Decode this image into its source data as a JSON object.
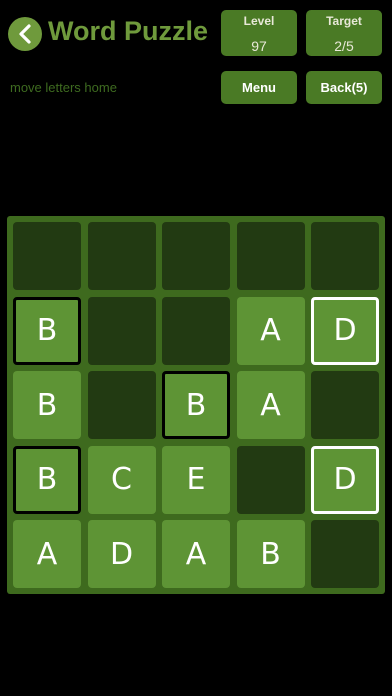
{
  "header": {
    "title": "Word Puzzle",
    "subtitle": "move letters home"
  },
  "level": {
    "label": "Level",
    "value": "97"
  },
  "target": {
    "label": "Target",
    "value": "2/5"
  },
  "buttons": {
    "menu": "Menu",
    "back": "Back(5)"
  },
  "colors": {
    "accent": "#6f9a3c",
    "tile": "#5e9435",
    "empty_cell": "#223a12",
    "board": "#3e6a1e"
  },
  "board": {
    "rows": [
      [
        {
          "letter": "",
          "state": "empty"
        },
        {
          "letter": "",
          "state": "empty"
        },
        {
          "letter": "",
          "state": "empty"
        },
        {
          "letter": "",
          "state": "empty"
        },
        {
          "letter": "",
          "state": "empty"
        }
      ],
      [
        {
          "letter": "B",
          "state": "home"
        },
        {
          "letter": "",
          "state": "empty"
        },
        {
          "letter": "",
          "state": "empty"
        },
        {
          "letter": "A",
          "state": "normal"
        },
        {
          "letter": "D",
          "state": "goal"
        }
      ],
      [
        {
          "letter": "B",
          "state": "normal"
        },
        {
          "letter": "",
          "state": "empty"
        },
        {
          "letter": "B",
          "state": "home"
        },
        {
          "letter": "A",
          "state": "normal"
        },
        {
          "letter": "",
          "state": "empty"
        }
      ],
      [
        {
          "letter": "B",
          "state": "home"
        },
        {
          "letter": "C",
          "state": "normal"
        },
        {
          "letter": "E",
          "state": "normal"
        },
        {
          "letter": "",
          "state": "empty"
        },
        {
          "letter": "D",
          "state": "goal"
        }
      ],
      [
        {
          "letter": "A",
          "state": "normal"
        },
        {
          "letter": "D",
          "state": "normal"
        },
        {
          "letter": "A",
          "state": "normal"
        },
        {
          "letter": "B",
          "state": "normal"
        },
        {
          "letter": "",
          "state": "empty"
        }
      ]
    ]
  }
}
